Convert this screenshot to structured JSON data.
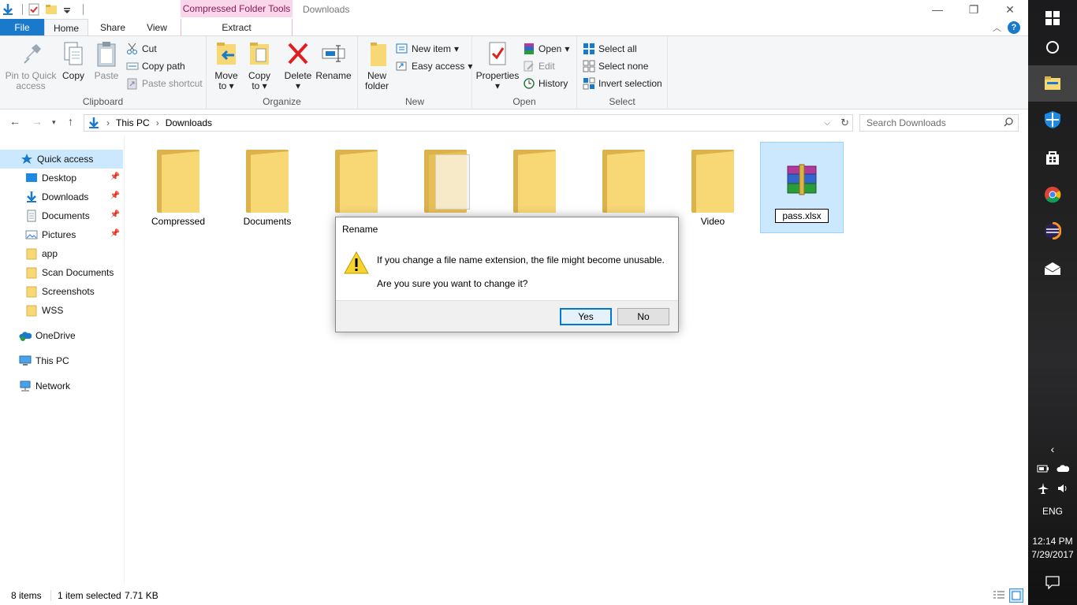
{
  "window": {
    "title": "Downloads",
    "context_tab": "Compressed Folder Tools",
    "controls": {
      "minimize": "—",
      "maximize": "❐",
      "close": "✕"
    }
  },
  "tabs": {
    "file": "File",
    "home": "Home",
    "share": "Share",
    "view": "View",
    "extract": "Extract"
  },
  "ribbon": {
    "clipboard": {
      "label": "Clipboard",
      "pin": "Pin to Quick access",
      "copy": "Copy",
      "paste": "Paste",
      "cut": "Cut",
      "copy_path": "Copy path",
      "paste_shortcut": "Paste shortcut"
    },
    "organize": {
      "label": "Organize",
      "move_to": "Move to",
      "copy_to": "Copy to",
      "delete": "Delete",
      "rename": "Rename"
    },
    "new": {
      "label": "New",
      "new_folder": "New folder",
      "new_item": "New item",
      "easy_access": "Easy access"
    },
    "open": {
      "label": "Open",
      "properties": "Properties",
      "open": "Open",
      "edit": "Edit",
      "history": "History"
    },
    "select": {
      "label": "Select",
      "select_all": "Select all",
      "select_none": "Select none",
      "invert": "Invert selection"
    }
  },
  "address": {
    "crumbs": [
      "This PC",
      "Downloads"
    ],
    "search_placeholder": "Search Downloads"
  },
  "nav": {
    "quick_access": "Quick access",
    "items": [
      {
        "label": "Desktop",
        "pinned": true
      },
      {
        "label": "Downloads",
        "pinned": true
      },
      {
        "label": "Documents",
        "pinned": true
      },
      {
        "label": "Pictures",
        "pinned": true
      },
      {
        "label": "app",
        "pinned": false
      },
      {
        "label": "Scan Documents",
        "pinned": false
      },
      {
        "label": "Screenshots",
        "pinned": false
      },
      {
        "label": "WSS",
        "pinned": false
      }
    ],
    "onedrive": "OneDrive",
    "this_pc": "This PC",
    "network": "Network"
  },
  "files": [
    {
      "name": "Compressed",
      "type": "folder"
    },
    {
      "name": "Documents",
      "type": "folder"
    },
    {
      "name": "",
      "type": "folder"
    },
    {
      "name": "",
      "type": "folder-doc"
    },
    {
      "name": "",
      "type": "folder"
    },
    {
      "name": "",
      "type": "folder"
    },
    {
      "name": "Video",
      "type": "folder"
    },
    {
      "name": "pass.xlsx",
      "type": "archive",
      "selected": true,
      "renaming": true
    }
  ],
  "dialog": {
    "title": "Rename",
    "message": "If you change a file name extension, the file might become unusable.",
    "question": "Are you sure you want to change it?",
    "yes": "Yes",
    "no": "No"
  },
  "status": {
    "items": "8 items",
    "selected": "1 item selected",
    "size": "7.71 KB"
  },
  "taskbar": {
    "time": "12:14 PM",
    "date": "7/29/2017",
    "lang": "ENG"
  },
  "colors": {
    "accent": "#1979ca",
    "selection": "#cce8ff",
    "context_tab": "#f9d6e9"
  }
}
